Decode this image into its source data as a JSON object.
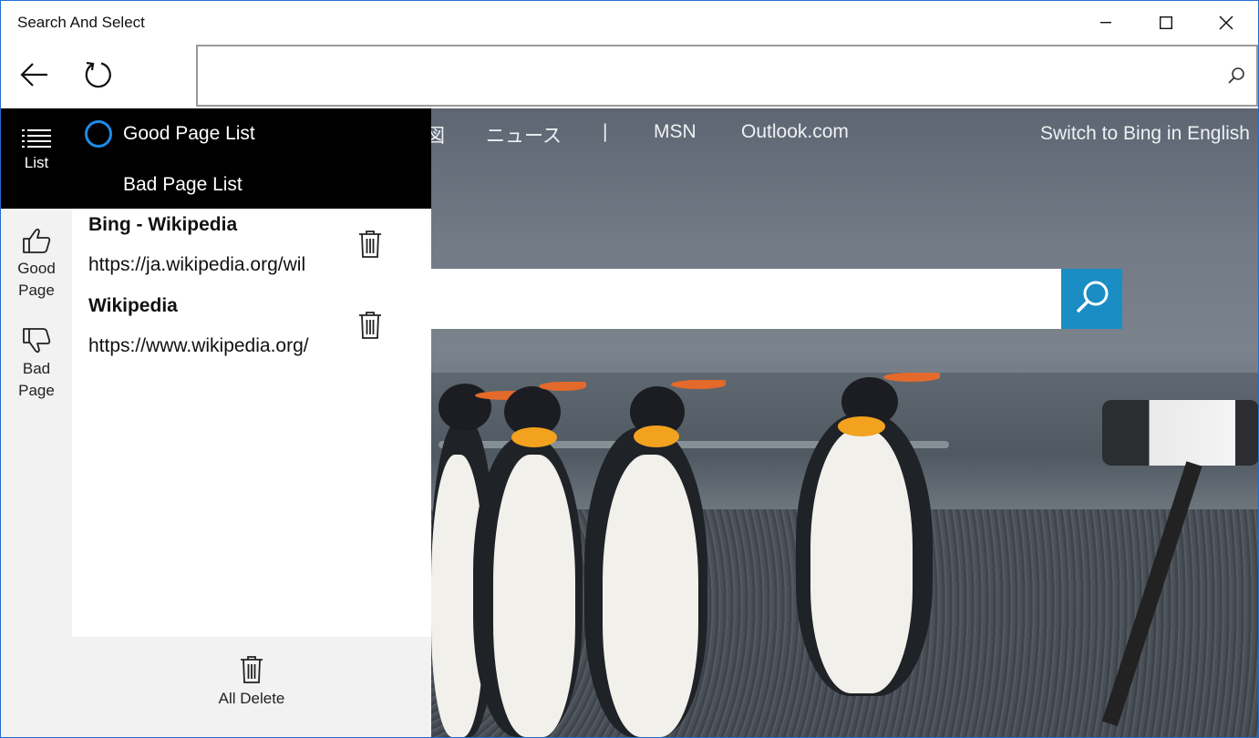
{
  "window": {
    "title": "Search And Select"
  },
  "address_bar": {
    "value": "",
    "placeholder": ""
  },
  "web_page": {
    "nav_links": [
      "ニュース",
      "|",
      "MSN",
      "Outlook.com"
    ],
    "partial_link": "図",
    "switch_language": "Switch to Bing in English",
    "accent_color": "#1a8dc4"
  },
  "rail": {
    "list_label": "List",
    "good_label_line1": "Good",
    "good_label_line2": "Page",
    "bad_label_line1": "Bad",
    "bad_label_line2": "Page"
  },
  "panel": {
    "options": [
      {
        "label": "Good Page List",
        "selected": true
      },
      {
        "label": "Bad Page List",
        "selected": false
      }
    ],
    "entries": [
      {
        "title": "Bing - Wikipedia",
        "url": "https://ja.wikipedia.org/wil"
      },
      {
        "title": "Wikipedia",
        "url": "https://www.wikipedia.org/"
      }
    ],
    "all_delete_label": "All Delete"
  }
}
